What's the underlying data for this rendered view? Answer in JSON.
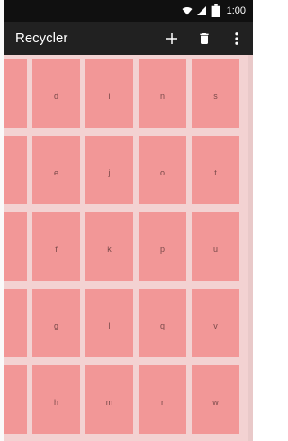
{
  "status": {
    "time": "1:00"
  },
  "toolbar": {
    "title": "Recycler",
    "actions": [
      {
        "name": "add",
        "icon": "plus-icon"
      },
      {
        "name": "delete",
        "icon": "trash-icon"
      },
      {
        "name": "more",
        "icon": "more-vert-icon"
      }
    ]
  },
  "grid": {
    "columns": [
      [
        "",
        "",
        "",
        "",
        ""
      ],
      [
        "d",
        "e",
        "f",
        "g",
        "h"
      ],
      [
        "i",
        "j",
        "k",
        "l",
        "m"
      ],
      [
        "n",
        "o",
        "p",
        "q",
        "r"
      ],
      [
        "s",
        "t",
        "u",
        "v",
        "w"
      ]
    ]
  },
  "colors": {
    "toolbar": "#212121",
    "status_bar": "#101010",
    "card": "#f29797",
    "background": "#f3d2d2"
  }
}
